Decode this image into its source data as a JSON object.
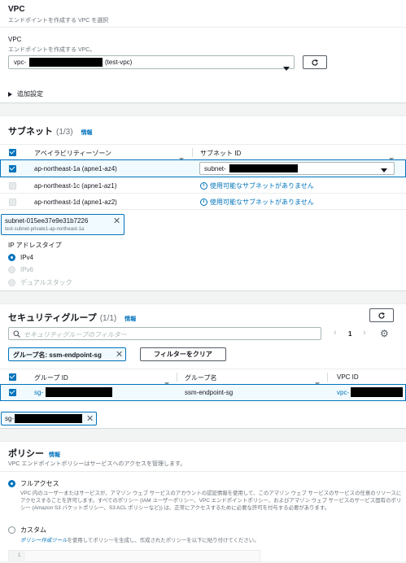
{
  "vpc": {
    "title": "VPC",
    "description": "エンドポイントを作成する VPC を選択",
    "field_label": "VPC",
    "field_hint": "エンドポイントを作成する VPC。",
    "select_prefix": "vpc-",
    "select_suffix": "(test-vpc)",
    "additional_settings": "追加設定"
  },
  "subnets": {
    "title": "サブネット",
    "count": "(1/3)",
    "info": "情報",
    "col_az": "アベイラビリティーゾーン",
    "col_subnet": "サブネット ID",
    "rows": [
      {
        "az": "ap-northeast-1a (apne1-az4)",
        "subnet_prefix": "subnet-",
        "checked": true
      },
      {
        "az": "ap-northeast-1c (apne1-az1)",
        "no_subnet": "使用可能なサブネットがありません",
        "checked": false
      },
      {
        "az": "ap-northeast-1d (apne1-az2)",
        "no_subnet": "使用可能なサブネットがありません",
        "checked": false
      }
    ],
    "token_id": "subnet-015ee37e9e31b7226",
    "token_name": "test-subnet-private1-ap-northeast-1a",
    "ip_type_label": "IP アドレスタイプ",
    "ip_options": [
      "IPv4",
      "IPv6",
      "デュアルスタック"
    ]
  },
  "security_groups": {
    "title": "セキュリティグループ",
    "count": "(1/1)",
    "info": "情報",
    "filter_placeholder": "セキュリティグループのフィルター",
    "page": "1",
    "filter_token": "グループ名: ssm-endpoint-sg",
    "clear_filter": "フィルターをクリア",
    "col_id": "グループ ID",
    "col_name": "グループ名",
    "col_vpc": "VPC ID",
    "row": {
      "id_prefix": "sg-",
      "name": "ssm-endpoint-sg",
      "vpc_prefix": "vpc-"
    },
    "token_prefix": "sg-"
  },
  "policy": {
    "title": "ポリシー",
    "info": "情報",
    "description": "VPC エンドポイントポリシーはサービスへのアクセスを管理します。",
    "full_access_label": "フルアクセス",
    "full_access_desc": "VPC 内のユーザーまたはサービスが、アマゾン ウェブ サービスのアカウントの認証情報を使用して、このアマゾン ウェブ サービスのサービスの任意のリソースにアクセスすることを許可します。すべてのポリシー (IAM ユーザーポリシー、VPC エンドポイントポリシー、およびアマゾン ウェブ サービスのサービス固有のポリシー (Amazon S3 バケットポリシー、S3 ACL ポリシーなど)) は、正常にアクセスするために必要な許可を付与する必要があります。",
    "custom_label": "カスタム",
    "custom_link": "ポリシー作成ツール",
    "custom_desc": "を使用してポリシーを生成し、作成されたポリシーを以下に貼り付けてください。",
    "editor_line": "1"
  },
  "colors": {
    "accent": "#0073bb",
    "border": "#aab7b8",
    "text": "#16191f",
    "muted": "#687078"
  }
}
